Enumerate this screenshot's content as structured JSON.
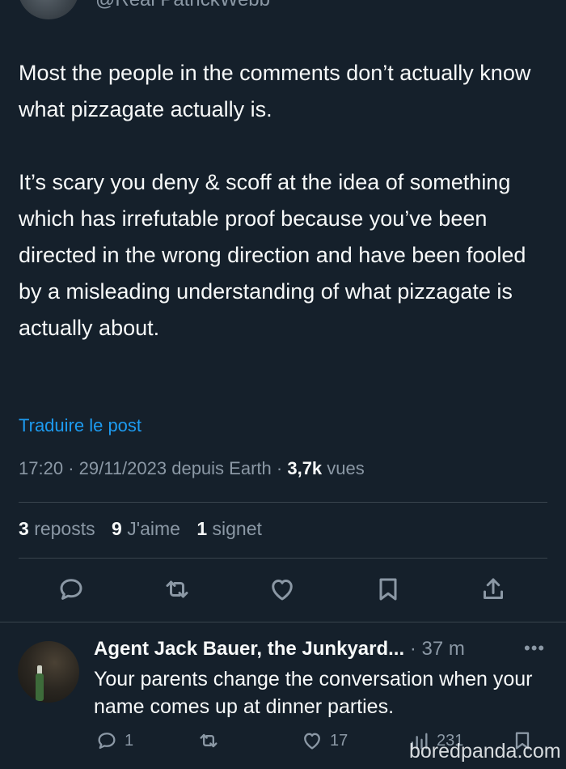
{
  "author": {
    "handle": "@Real PatrickWebb"
  },
  "post": {
    "paragraphs": [
      "Most the people in the comments don’t actually know what pizzagate actually is.",
      "It’s scary you deny & scoff at the idea of something which has irrefutable proof because you’ve been directed in the wrong direction and have been fooled by a misleading understanding of what pizzagate is actually about."
    ],
    "translate_label": "Traduire le post",
    "meta": {
      "time": "17:20",
      "separator": "·",
      "date_source": "29/11/2023 depuis Earth",
      "views_count": "3,7k",
      "views_label": "vues"
    }
  },
  "stats": [
    {
      "count": "3",
      "label": "reposts"
    },
    {
      "count": "9",
      "label": "J'aime"
    },
    {
      "count": "1",
      "label": "signet"
    }
  ],
  "actions": [
    "reply-icon",
    "repost-icon",
    "like-icon",
    "bookmark-icon",
    "share-icon"
  ],
  "reply": {
    "name": "Agent Jack Bauer, the Junkyard...",
    "time": "· 37 m",
    "more": "•••",
    "text": "Your parents change the conversation when your name comes up at dinner parties.",
    "counts": {
      "replies": "1",
      "likes": "17",
      "views": "231"
    }
  },
  "watermark": "boredpanda.com",
  "colors": {
    "background": "#15202b",
    "text": "#f7f9f9",
    "muted": "#8b98a5",
    "link": "#1d9bf0",
    "divider": "#38444d"
  }
}
